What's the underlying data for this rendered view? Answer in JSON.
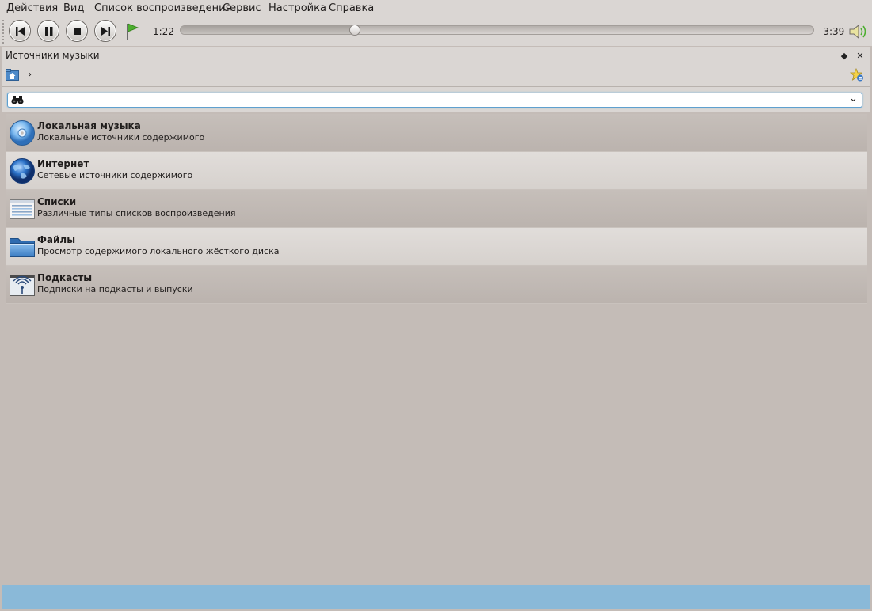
{
  "menu": [
    "Действия",
    "Вид",
    "Список воспроизведения",
    "Сервис",
    "Настройка",
    "Справка"
  ],
  "player": {
    "time_elapsed": "1:22",
    "time_remaining": "-3:39",
    "progress_fraction": 0.275
  },
  "panel": {
    "title": "Источники музыки",
    "search": {
      "value": "",
      "placeholder": ""
    },
    "categories": [
      {
        "title": "Локальная музыка",
        "subtitle": "Локальные источники содержимого",
        "icon": "disc-icon"
      },
      {
        "title": "Интернет",
        "subtitle": "Сетевые источники содержимого",
        "icon": "globe-icon"
      },
      {
        "title": "Списки",
        "subtitle": "Различные типы списков воспроизведения",
        "icon": "playlist-icon"
      },
      {
        "title": "Файлы",
        "subtitle": "Просмотр содержимого локального жёсткого диска",
        "icon": "folder-icon"
      },
      {
        "title": "Подкасты",
        "subtitle": "Подписки на подкасты и выпуски",
        "icon": "podcast-icon"
      }
    ]
  },
  "colors": {
    "accent": "#8ab9d8",
    "focus": "#5fa0cf",
    "background": "#c4bcb7",
    "chrome": "#dad6d3"
  }
}
